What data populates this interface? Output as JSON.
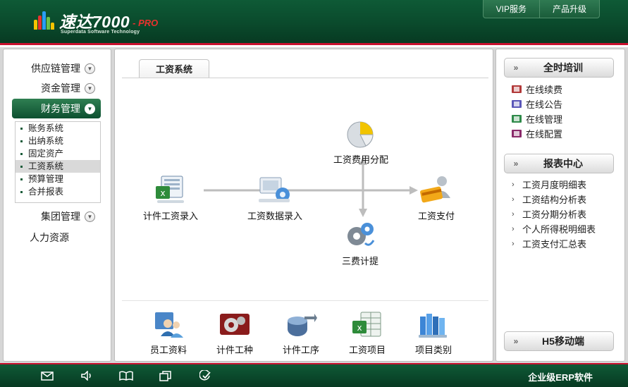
{
  "header": {
    "logo_main": "速达7000",
    "logo_pro": "- PRO",
    "logo_sub": "Superdata Software Technology",
    "buttons": [
      "VIP服务",
      "产品升级"
    ]
  },
  "sidebar": {
    "items": [
      {
        "label": "供应链管理"
      },
      {
        "label": "资金管理"
      },
      {
        "label": "财务管理"
      },
      {
        "label": "集团管理"
      },
      {
        "label": "人力资源"
      }
    ],
    "submenu": [
      "账务系统",
      "出纳系统",
      "固定资产",
      "工资系统",
      "预算管理",
      "合并报表"
    ]
  },
  "center": {
    "tab": "工资系统",
    "flow": {
      "piece_entry": "计件工资录入",
      "data_entry": "工资数据录入",
      "cost_alloc": "工资费用分配",
      "three_fee": "三费计提",
      "payment": "工资支付"
    },
    "bottom": [
      "员工资料",
      "计件工种",
      "计件工序",
      "工资项目",
      "项目类别"
    ]
  },
  "right": {
    "training": {
      "title": "全时培训",
      "items": [
        "在线续费",
        "在线公告",
        "在线管理",
        "在线配置"
      ]
    },
    "reports": {
      "title": "报表中心",
      "items": [
        "工资月度明细表",
        "工资结构分析表",
        "工资分期分析表",
        "个人所得税明细表",
        "工资支付汇总表"
      ]
    },
    "mobile": {
      "title": "H5移动端"
    }
  },
  "footer": {
    "text": "企业级ERP软件"
  },
  "colors": {
    "header_green": "#0a4a2c",
    "accent_red": "#c8102e",
    "active_green": "#1a6a40"
  }
}
